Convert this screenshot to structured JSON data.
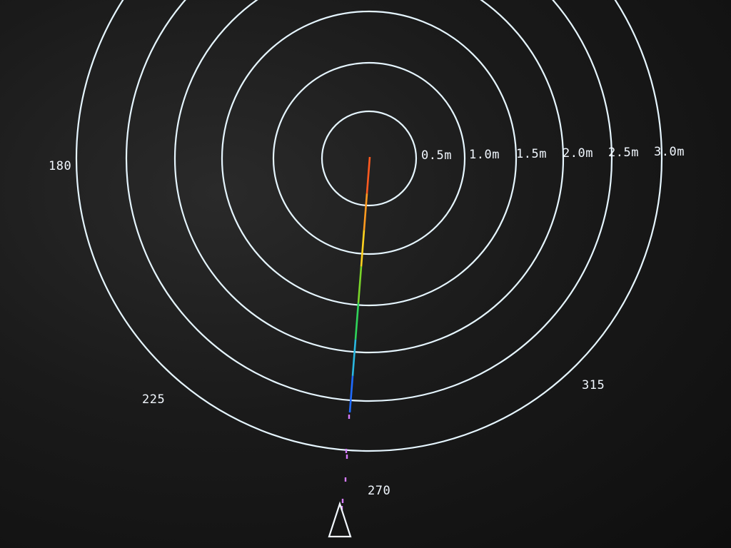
{
  "radar": {
    "range_labels": [
      "0.5m",
      "1.0m",
      "1.5m",
      "2.0m",
      "2.5m",
      "3.0m"
    ],
    "angle_labels": {
      "a180": "180",
      "a225": "225",
      "a270": "270",
      "a315": "315"
    },
    "ring_color": "#e6f6ff",
    "trace_colors": [
      "#ff5a1f",
      "#ff9a1f",
      "#ffd21f",
      "#7ad42a",
      "#2fd45a",
      "#2ab8e0",
      "#1f6bff",
      "#d67cff"
    ]
  }
}
